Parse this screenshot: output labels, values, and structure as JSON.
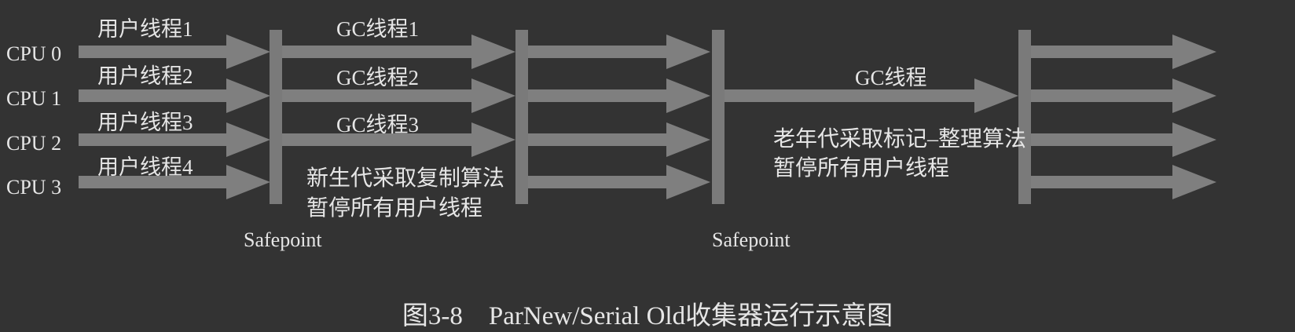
{
  "cpus": [
    "CPU 0",
    "CPU 1",
    "CPU 2",
    "CPU 3"
  ],
  "user_threads": [
    "用户线程1",
    "用户线程2",
    "用户线程3",
    "用户线程4"
  ],
  "young_gc_threads": [
    "GC线程1",
    "GC线程2",
    "GC线程3"
  ],
  "young_gc_note": [
    "新生代采取复制算法",
    "暂停所有用户线程"
  ],
  "old_gc_thread": "GC线程",
  "old_gc_note": [
    "老年代采取标记–整理算法",
    "暂停所有用户线程"
  ],
  "safepoint_label": "Safepoint",
  "caption": "图3-8　ParNew/Serial Old收集器运行示意图",
  "colors": {
    "background": "#333333",
    "arrow": "#7f7f7f",
    "arrow_dim": "#6b6b6b",
    "bar": "#7a7a7a",
    "text": "#e6e6e6"
  }
}
